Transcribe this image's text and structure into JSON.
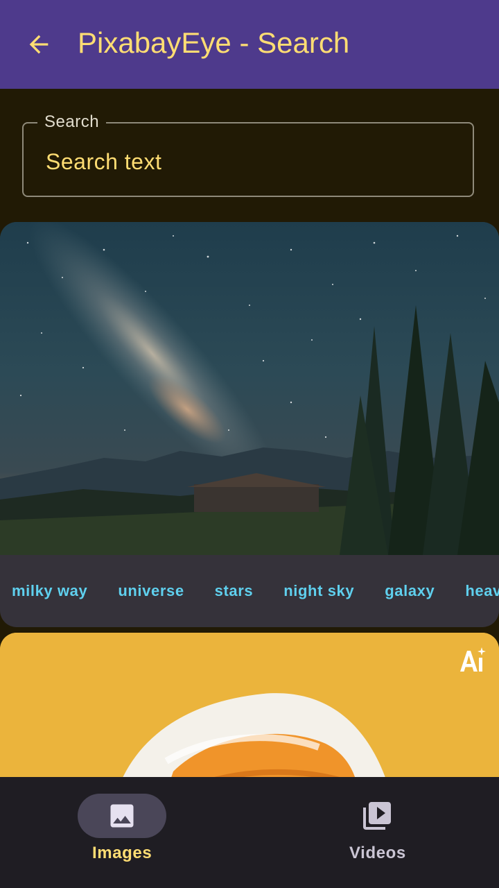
{
  "app_bar": {
    "title": "PixabayEye - Search",
    "back_icon": "arrow-back-icon",
    "background": "#4e3a8c",
    "title_color": "#ffdd73"
  },
  "search": {
    "label": "Search",
    "placeholder": "Search text",
    "value": ""
  },
  "results": [
    {
      "image": "milky-way-night-sky-photo",
      "tags": [
        "milky way",
        "universe",
        "stars",
        "night sky",
        "galaxy",
        "heave"
      ]
    },
    {
      "image": "towel-photo",
      "badge_icon": "ai-generated-icon"
    }
  ],
  "bottom_nav": {
    "items": [
      {
        "label": "Images",
        "icon": "image-icon",
        "selected": true
      },
      {
        "label": "Videos",
        "icon": "video-library-icon",
        "selected": false
      }
    ],
    "selected_color": "#ffdd73",
    "unselected_color": "#cac5d4"
  }
}
